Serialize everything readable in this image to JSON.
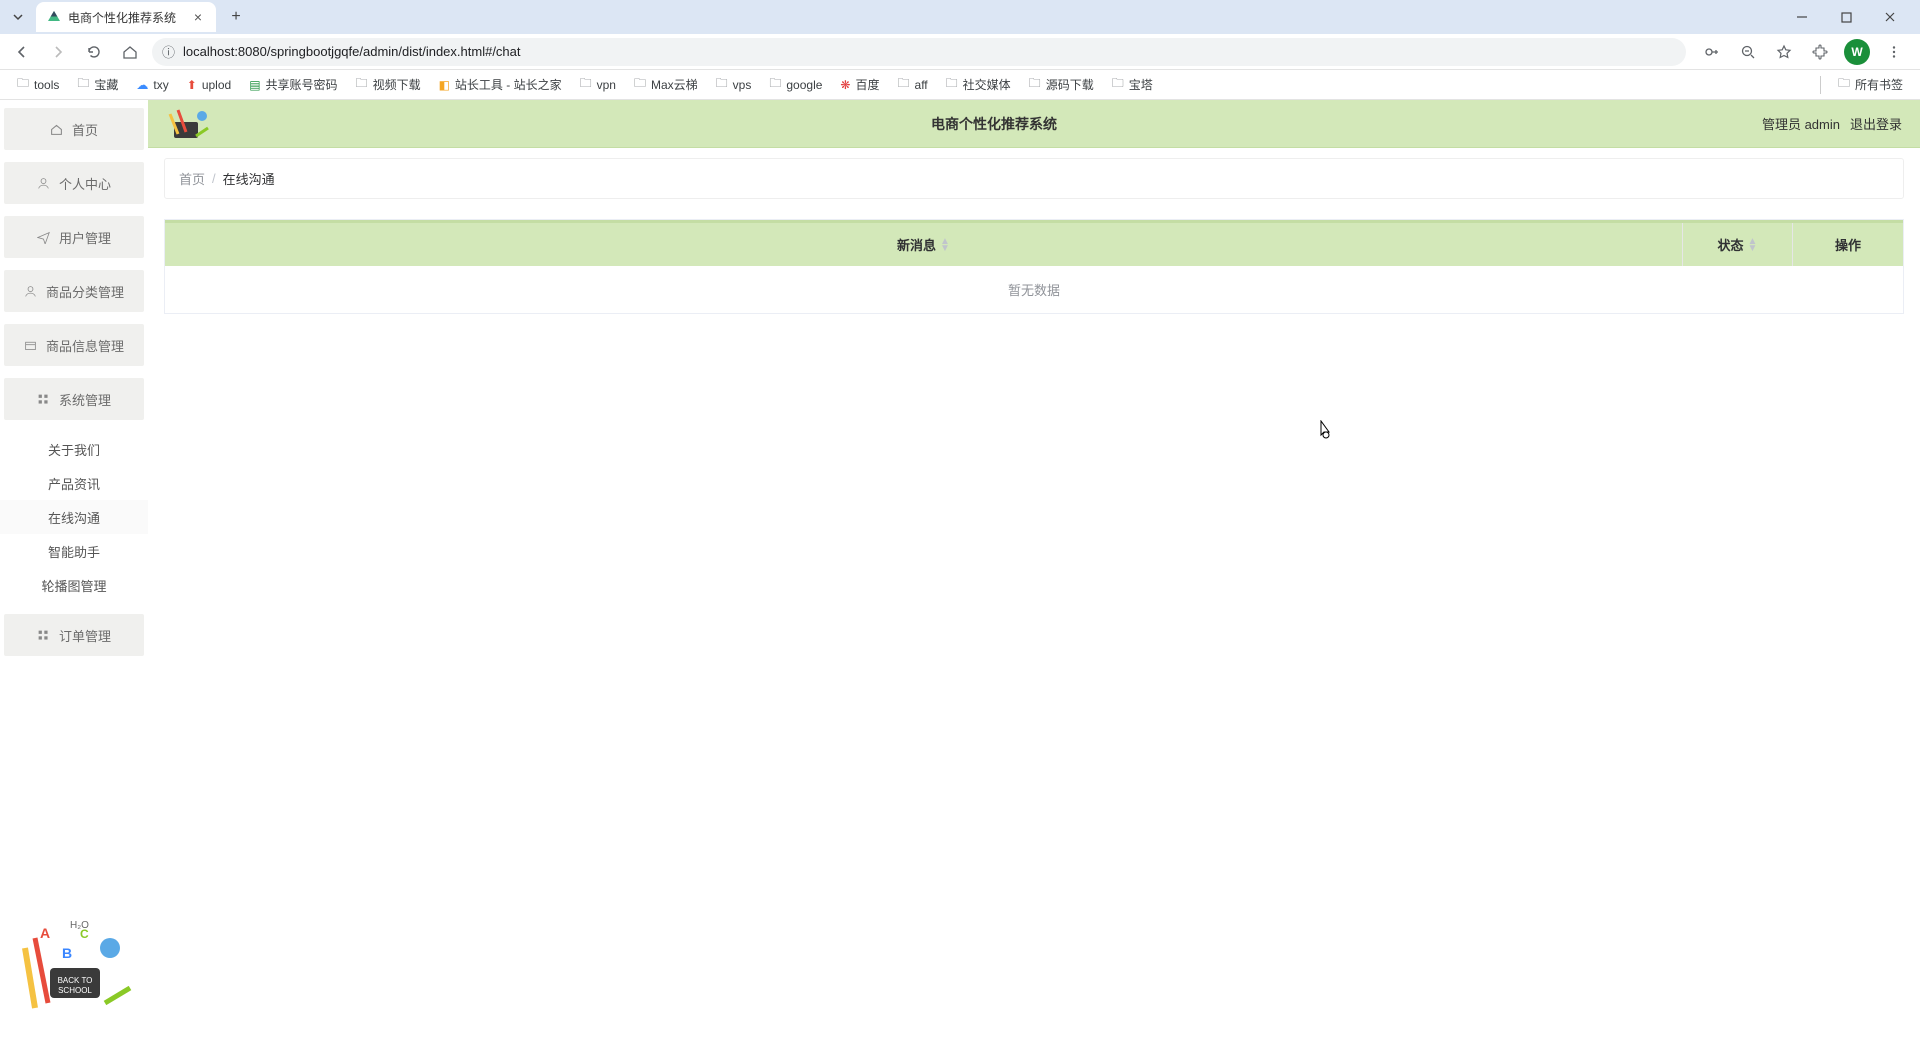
{
  "browser": {
    "tab_title": "电商个性化推荐系统",
    "url": "localhost:8080/springbootjgqfe/admin/dist/index.html#/chat",
    "profile_letter": "W",
    "bookmarks": [
      "tools",
      "宝藏",
      "txy",
      "uplod",
      "共享账号密码",
      "视频下载",
      "站长工具 - 站长之家",
      "vpn",
      "Max云梯",
      "vps",
      "google",
      "百度",
      "aff",
      "社交媒体",
      "源码下载",
      "宝塔"
    ],
    "all_bookmarks": "所有书签"
  },
  "sidebar": {
    "items": [
      {
        "label": "首页"
      },
      {
        "label": "个人中心"
      },
      {
        "label": "用户管理"
      },
      {
        "label": "商品分类管理"
      },
      {
        "label": "商品信息管理"
      },
      {
        "label": "系统管理"
      }
    ],
    "subs": [
      {
        "label": "关于我们"
      },
      {
        "label": "产品资讯"
      },
      {
        "label": "在线沟通",
        "active": true
      },
      {
        "label": "智能助手"
      },
      {
        "label": "轮播图管理"
      }
    ],
    "item_orders": {
      "label": "订单管理"
    }
  },
  "header": {
    "title": "电商个性化推荐系统",
    "user": "管理员 admin",
    "logout": "退出登录"
  },
  "breadcrumb": {
    "home": "首页",
    "sep": "/",
    "current": "在线沟通"
  },
  "table": {
    "col_msg": "新消息",
    "col_status": "状态",
    "col_op": "操作",
    "empty": "暂无数据"
  }
}
